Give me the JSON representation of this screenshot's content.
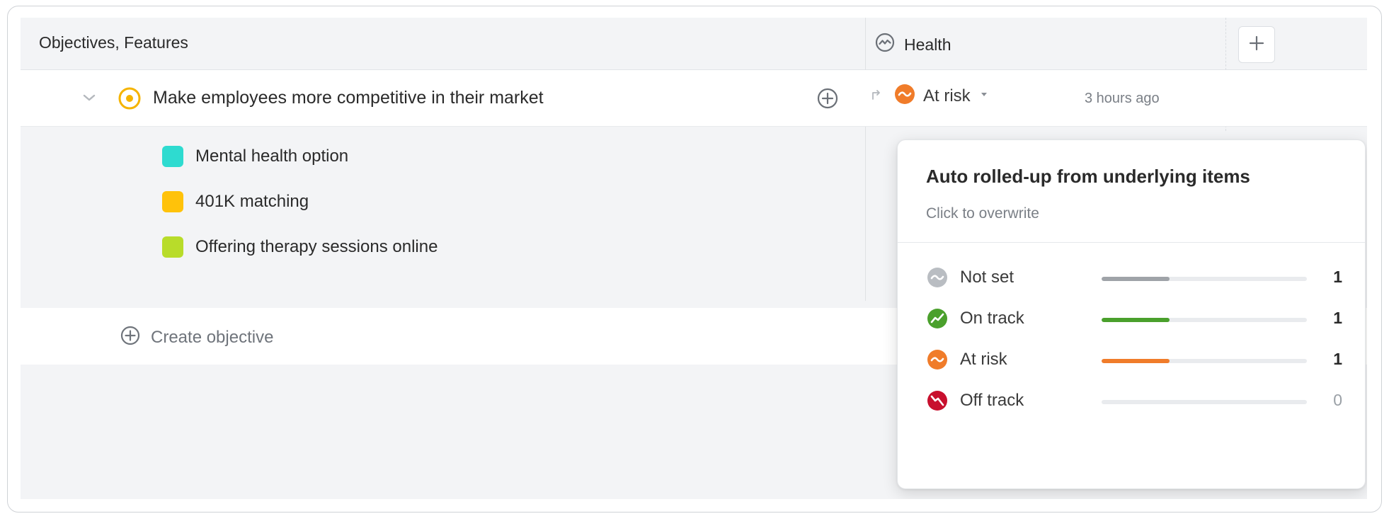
{
  "header": {
    "objectives_label": "Objectives, Features",
    "health_label": "Health"
  },
  "objective": {
    "title": "Make employees more competitive in their market",
    "status": "At risk",
    "updated": "3 hours ago"
  },
  "features": [
    {
      "label": "Mental health option",
      "color": "#2edbd0"
    },
    {
      "label": "401K matching",
      "color": "#ffc20a"
    },
    {
      "label": "Offering therapy sessions online",
      "color": "#b8dc2a"
    }
  ],
  "create_label": "Create objective",
  "popover": {
    "title": "Auto rolled-up from underlying items",
    "subtitle": "Click to overwrite",
    "rows": [
      {
        "label": "Not set",
        "count": "1",
        "fill_fraction": 0.33,
        "color": "#9fa3a8"
      },
      {
        "label": "On track",
        "count": "1",
        "fill_fraction": 0.33,
        "color": "#4aa02c"
      },
      {
        "label": "At risk",
        "count": "1",
        "fill_fraction": 0.33,
        "color": "#f07c2a"
      },
      {
        "label": "Off track",
        "count": "0",
        "fill_fraction": 0,
        "color": "#c8102e"
      }
    ]
  },
  "colors": {
    "target_icon": "#f5b400",
    "at_risk": "#f07c2a",
    "on_track": "#4aa02c",
    "off_track": "#c8102e",
    "not_set": "#b9bdc2"
  }
}
